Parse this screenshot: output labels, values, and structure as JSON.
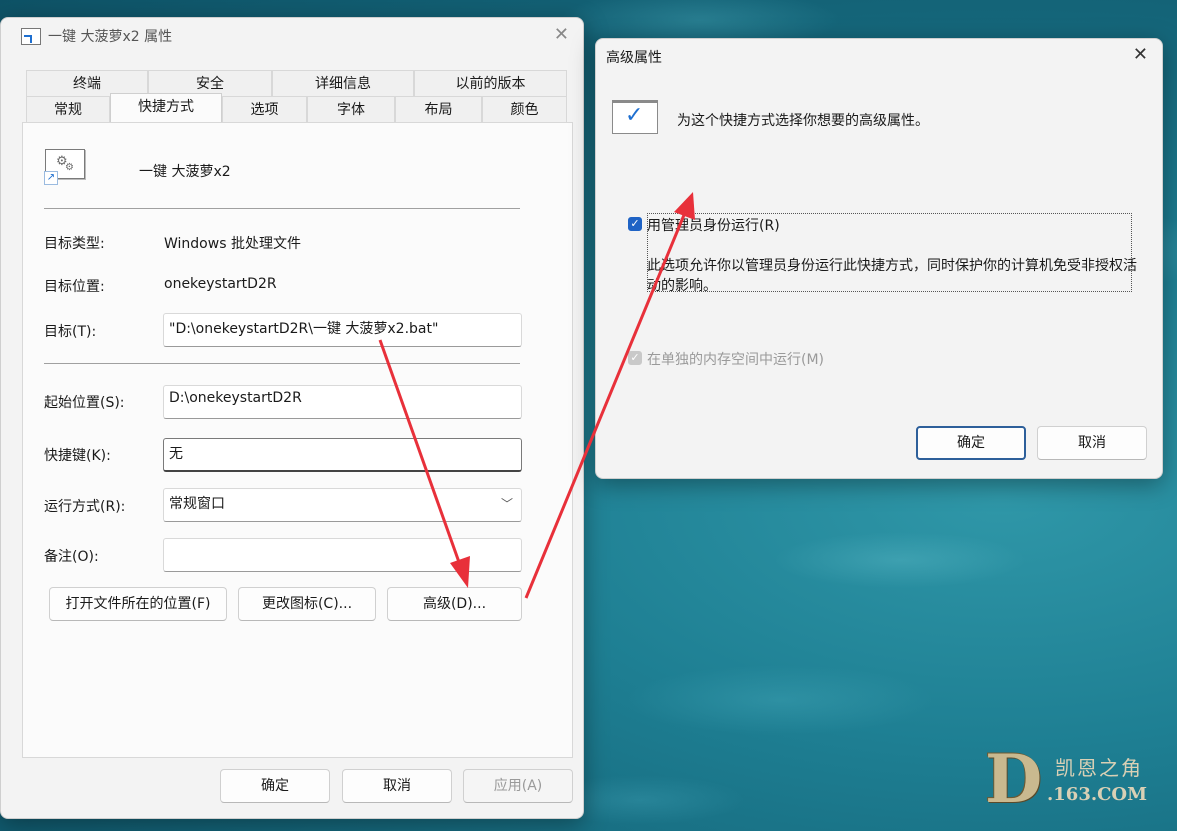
{
  "properties_dialog": {
    "title": "一键 大菠萝x2 属性",
    "close_glyph": "✕",
    "tabs_row1": [
      "终端",
      "安全",
      "详细信息",
      "以前的版本"
    ],
    "tabs_row2": [
      "常规",
      "快捷方式",
      "选项",
      "字体",
      "布局",
      "颜色"
    ],
    "active_tab": "快捷方式",
    "shortcut_name": "一键 大菠萝x2",
    "target_type_label": "目标类型:",
    "target_type_value": "Windows 批处理文件",
    "target_location_label": "目标位置:",
    "target_location_value": "onekeystartD2R",
    "target_label": "目标(T):",
    "target_value": "\"D:\\onekeystartD2R\\一键 大菠萝x2.bat\"",
    "start_in_label": "起始位置(S):",
    "start_in_value": "D:\\onekeystartD2R",
    "hotkey_label": "快捷键(K):",
    "hotkey_value": "无",
    "run_label": "运行方式(R):",
    "run_value": "常规窗口",
    "comment_label": "备注(O):",
    "comment_value": "",
    "open_location_button": "打开文件所在的位置(F)",
    "change_icon_button": "更改图标(C)...",
    "advanced_button": "高级(D)...",
    "ok_button": "确定",
    "cancel_button": "取消",
    "apply_button": "应用(A)"
  },
  "advanced_dialog": {
    "title": "高级属性",
    "close_glyph": "✕",
    "description": "为这个快捷方式选择你想要的高级属性。",
    "run_as_admin_label": "用管理员身份运行(R)",
    "run_as_admin_checked": true,
    "run_as_admin_note": "此选项允许你以管理员身份运行此快捷方式，同时保护你的计算机免受非授权活动的影响。",
    "separate_memory_label": "在单独的内存空间中运行(M)",
    "separate_memory_checked": true,
    "separate_memory_enabled": false,
    "ok_button": "确定",
    "cancel_button": "取消"
  },
  "watermark": {
    "logo_letter": "D",
    "line1": "凯恩之角",
    "line2": ".163.COM"
  },
  "colors": {
    "accent": "#1f63c5",
    "annotation_arrow": "#e8303a"
  }
}
